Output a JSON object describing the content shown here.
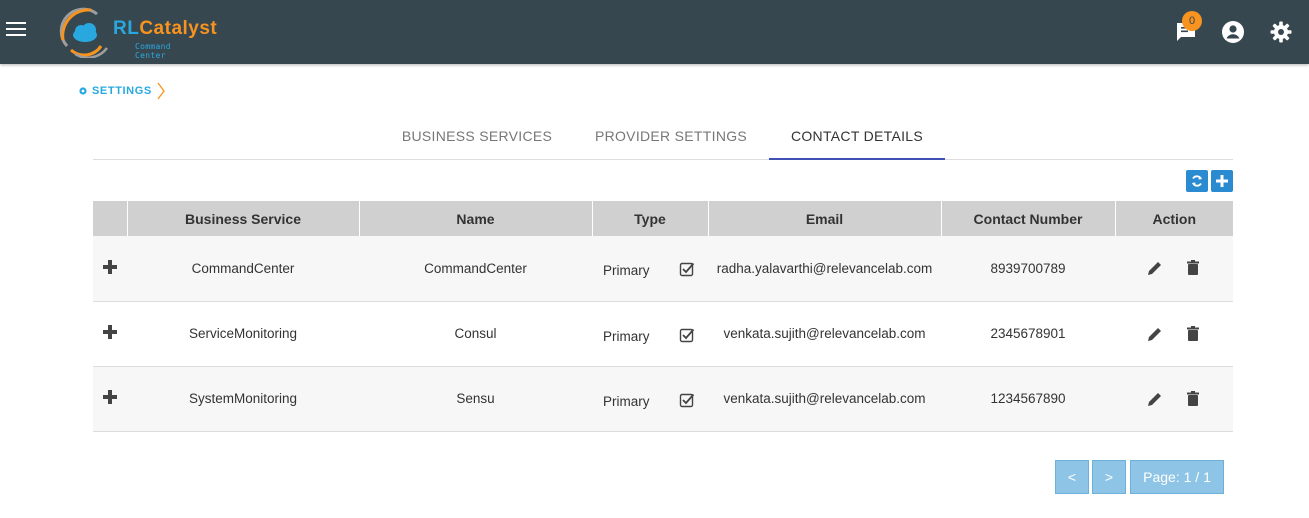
{
  "header": {
    "logo": {
      "brand_rl": "RL",
      "brand_rest": "Catalyst",
      "tagline": "Command Center"
    },
    "notifications_count": "0",
    "icons": [
      "menu-icon",
      "chat-icon",
      "account-icon",
      "settings-icon"
    ]
  },
  "breadcrumb": {
    "label": "SETTINGS"
  },
  "tabs": [
    {
      "label": "BUSINESS SERVICES",
      "active": false
    },
    {
      "label": "PROVIDER SETTINGS",
      "active": false
    },
    {
      "label": "CONTACT DETAILS",
      "active": true
    }
  ],
  "table": {
    "columns": [
      "",
      "Business Service",
      "Name",
      "Type",
      "Email",
      "Contact Number",
      "Action"
    ],
    "rows": [
      {
        "business_service": "CommandCenter",
        "name": "CommandCenter",
        "type": "Primary",
        "primary_checked": true,
        "email": "radha.yalavarthi@relevancelab.com",
        "contact": "8939700789"
      },
      {
        "business_service": "ServiceMonitoring",
        "name": "Consul",
        "type": "Primary",
        "primary_checked": true,
        "email": "venkata.sujith@relevancelab.com",
        "contact": "2345678901"
      },
      {
        "business_service": "SystemMonitoring",
        "name": "Sensu",
        "type": "Primary",
        "primary_checked": true,
        "email": "venkata.sujith@relevancelab.com",
        "contact": "1234567890"
      }
    ]
  },
  "pagination": {
    "prev": "<",
    "next": ">",
    "page_label": "Page: 1 / 1"
  },
  "colors": {
    "topbar": "#37474f",
    "accent": "#29a8e0",
    "brand_orange": "#f7931e",
    "tab_indicator": "#3f51b5",
    "pager": "#8ec5e6"
  }
}
